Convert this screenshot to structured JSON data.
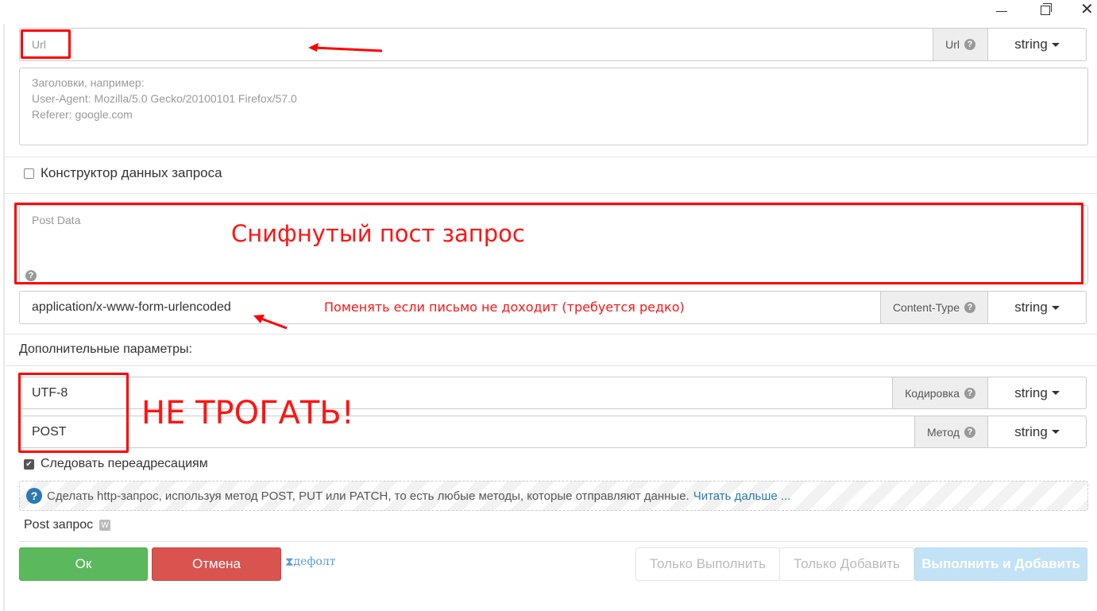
{
  "window": {
    "close_glyph": "✕"
  },
  "url_row": {
    "placeholder": "Url",
    "addon": "Url",
    "type": "string"
  },
  "headers": {
    "line1": "Заголовки, например:",
    "line2": "User-Agent: Mozilla/5.0 Gecko/20100101 Firefox/57.0",
    "line3": "Referer: google.com"
  },
  "constructor_label": "Конструктор данных запроса",
  "post_data": {
    "placeholder": "Post Data"
  },
  "content_type_row": {
    "value": "application/x-www-form-urlencoded",
    "addon": "Content-Type",
    "type": "string"
  },
  "extra_params_label": "Дополнительные параметры:",
  "encoding_row": {
    "value": "UTF-8",
    "addon": "Кодировка",
    "type": "string"
  },
  "method_row": {
    "value": "POST",
    "addon": "Метод",
    "type": "string"
  },
  "follow_redirects_label": "Следовать переадресациям",
  "info": {
    "text": "Сделать http-запрос, используя метод POST, PUT или PATCH, то есть любые методы, которые отправляют данные.",
    "link": "Читать дальше ..."
  },
  "action_name": "Post запрос",
  "buttons": {
    "ok": "Ок",
    "cancel": "Отмена",
    "default": "дефолт",
    "only_run": "Только Выполнить",
    "only_add": "Только Добавить",
    "run_and_add": "Выполнить и Добавить"
  },
  "annotations": {
    "sniffed": "Снифнутый пост запрос",
    "change_hint": "Поменять если письмо не доходит (требуется редко)",
    "do_not_touch": "НЕ ТРОГАТЬ!"
  },
  "colors": {
    "annotation_red": "#ff0000",
    "ok_green": "#5cb85c",
    "cancel_red": "#d9534f",
    "link_blue": "#2a7ab0"
  },
  "icons": {
    "help": "question-icon",
    "info": "info-icon",
    "check": "check-icon",
    "hourglass": "hourglass-icon",
    "wordpress": "wordpress-icon"
  }
}
